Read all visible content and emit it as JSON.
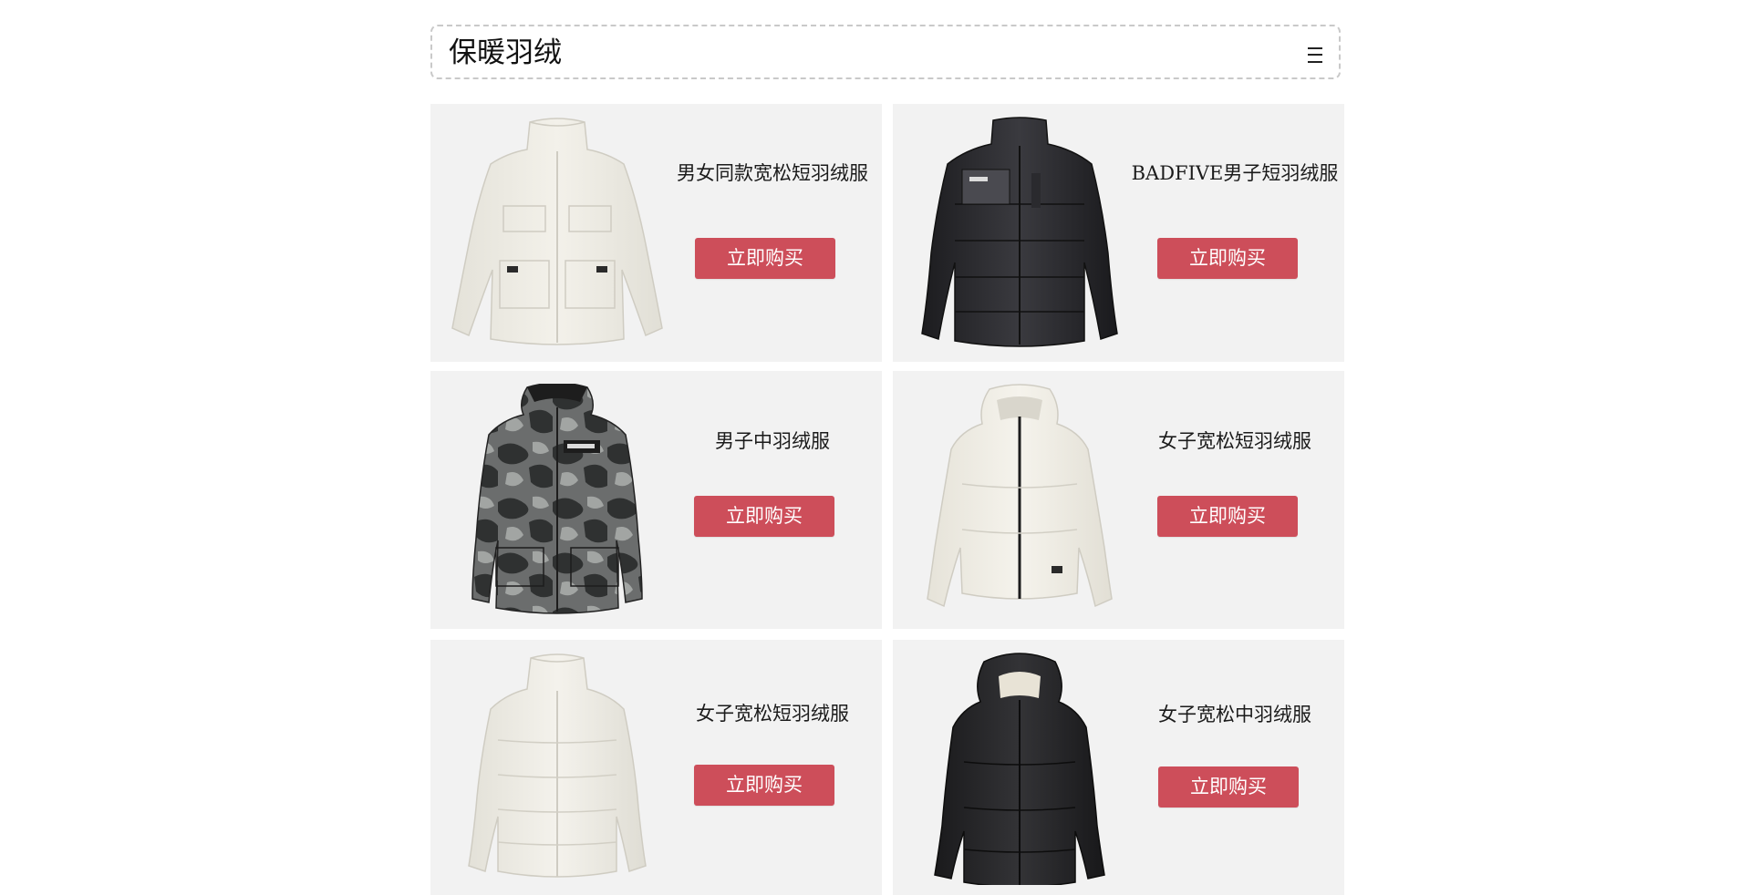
{
  "header": {
    "title": "保暖羽绒",
    "menu_icon": "hamburger-menu-icon"
  },
  "colors": {
    "card_background": "#f2f2f2",
    "button_background": "#cd4e5a",
    "button_text": "#ffffff",
    "header_border": "#c9c9c9"
  },
  "products": [
    {
      "name": "男女同款宽松短羽绒服",
      "button_label": "立即购买",
      "image": "cream-short-down-jacket-with-flap-pockets"
    },
    {
      "name": "BADFIVE男子短羽绒服",
      "button_label": "立即购买",
      "image": "black-puffer-jacket-with-chest-panel"
    },
    {
      "name": "男子中羽绒服",
      "button_label": "立即购买",
      "image": "camouflage-hooded-parka"
    },
    {
      "name": "女子宽松短羽绒服",
      "button_label": "立即购买",
      "image": "cream-hooded-zip-puffer"
    },
    {
      "name": "女子宽松短羽绒服",
      "button_label": "立即购买",
      "image": "cream-high-collar-puffer"
    },
    {
      "name": "女子宽松中羽绒服",
      "button_label": "立即购买",
      "image": "black-hooded-mid-length-puffer"
    }
  ]
}
